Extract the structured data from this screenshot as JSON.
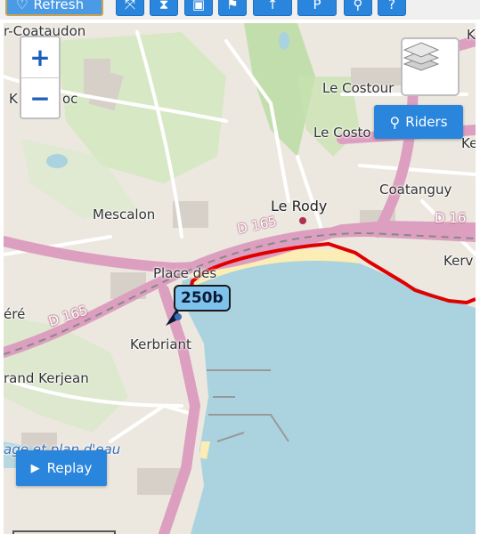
{
  "toolbar": {
    "refresh_label": "Refresh",
    "buttons": [
      "fit-icon",
      "hourglass-icon",
      "image-icon",
      "flag-icon",
      "up-icon",
      "p-icon",
      "link-icon",
      "help-icon"
    ]
  },
  "map": {
    "zoom_in": "+",
    "zoom_out": "−",
    "riders_label": "Riders",
    "replay_label": "Replay",
    "marker_label": "250b",
    "places": {
      "coataudon": "r-Coataudon",
      "kerhoc": "K",
      "kerhoc2": "oc",
      "le_costour": "Le Costour",
      "le_costo": "Le Costo",
      "mescalon": "Mescalon",
      "le_rody": "Le Rody",
      "coatanguy": "Coatanguy",
      "kerv": "Kerv",
      "ker": "Ker",
      "place_des": "Place des",
      "kerbriant": "Kerbriant",
      "ere": "éré",
      "grand_kerjean": "rand Kerjean",
      "plage": "age et plan d'eau",
      "k_right": "K"
    },
    "roads": {
      "d165_left": "D 165",
      "d165_top": "D 165",
      "d16_right": "D 16"
    },
    "colors": {
      "water": "#aad3df",
      "beach": "#fbedb3",
      "road": "#dd9fc0",
      "route": "#e00000",
      "button": "#2a86dd",
      "marker": "#7ec3ee"
    }
  }
}
